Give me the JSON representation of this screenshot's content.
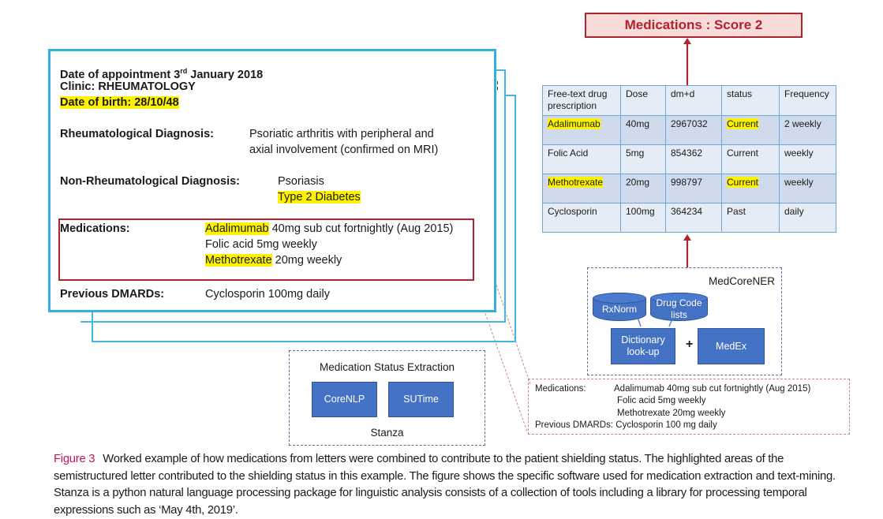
{
  "score_box": {
    "label": "Medications : Score 2"
  },
  "letter": {
    "appointment_prefix": "Date of appointment 3",
    "appointment_sup": "rd",
    "appointment_suffix": " January 2018",
    "clinic": "Clinic: RHEUMATOLOGY",
    "dob": "Date of birth: 28/10/48",
    "rheum_label": "Rheumatological Diagnosis:",
    "rheum_line1": "Psoriatic arthritis with peripheral and",
    "rheum_line2": "axial involvement (confirmed on MRI)",
    "nonrheum_label": "Non-Rheumatological Diagnosis:",
    "nonrheum_line1": "Psoriasis",
    "nonrheum_line2": "Type 2 Diabetes",
    "med_label": "Medications:",
    "med1_drug": "Adalimumab",
    "med1_rest": " 40mg sub cut fortnightly (Aug 2015)",
    "med2": "Folic acid 5mg weekly",
    "med3_drug": "Methotrexate",
    "med3_rest": " 20mg weekly",
    "dmards_label": "Previous DMARDs:",
    "dmards_value": "Cyclosporin 100mg daily"
  },
  "table": {
    "headers": [
      "Free-text drug prescription",
      "Dose",
      "dm+d",
      "status",
      "Frequency"
    ],
    "rows": [
      {
        "drug": "Adalimumab",
        "dose": "40mg",
        "dmd": "2967032",
        "status": "Current",
        "frequency": "2 weekly",
        "highlight": true
      },
      {
        "drug": "Folic Acid",
        "dose": "5mg",
        "dmd": "854362",
        "status": "Current",
        "frequency": "weekly",
        "highlight": false
      },
      {
        "drug": "Methotrexate",
        "dose": "20mg",
        "dmd": "998797",
        "status": "Current",
        "frequency": "weekly",
        "highlight": true
      },
      {
        "drug": "Cyclosporin",
        "dose": "100mg",
        "dmd": "364234",
        "status": "Past",
        "frequency": "daily",
        "highlight": false
      }
    ]
  },
  "medcore": {
    "title": "MedCoreNER",
    "rxnorm": "RxNorm",
    "drug_code_lists": "Drug Code lists",
    "dictionary": "Dictionary look-up",
    "plus": "+",
    "medex": "MedEx"
  },
  "status_extraction": {
    "title": "Medication Status Extraction",
    "corenlp": "CoreNLP",
    "sutime": "SUTime",
    "footer": "Stanza"
  },
  "extract": {
    "med_label": "Medications:",
    "line1": "Adalimumab 40mg sub cut fortnightly (Aug 2015)",
    "line2": "Folic acid 5mg weekly",
    "line3": "Methotrexate 20mg weekly",
    "dmards_label": "Previous DMARDs:",
    "dmards_value": "Cyclosporin 100 mg daily"
  },
  "caption": {
    "figure_label": "Figure 3",
    "text": "Worked example of how medications from letters were combined to contribute to the patient shielding status. The highlighted areas of the semistructured letter contributed to the shielding status in this example. The figure shows the specific software used for medication extraction and text-mining. Stanza is a python natural language processing package for linguistic analysis consists of a collection of tools including a library for processing temporal expressions such as ‘May 4th, 2019’."
  }
}
